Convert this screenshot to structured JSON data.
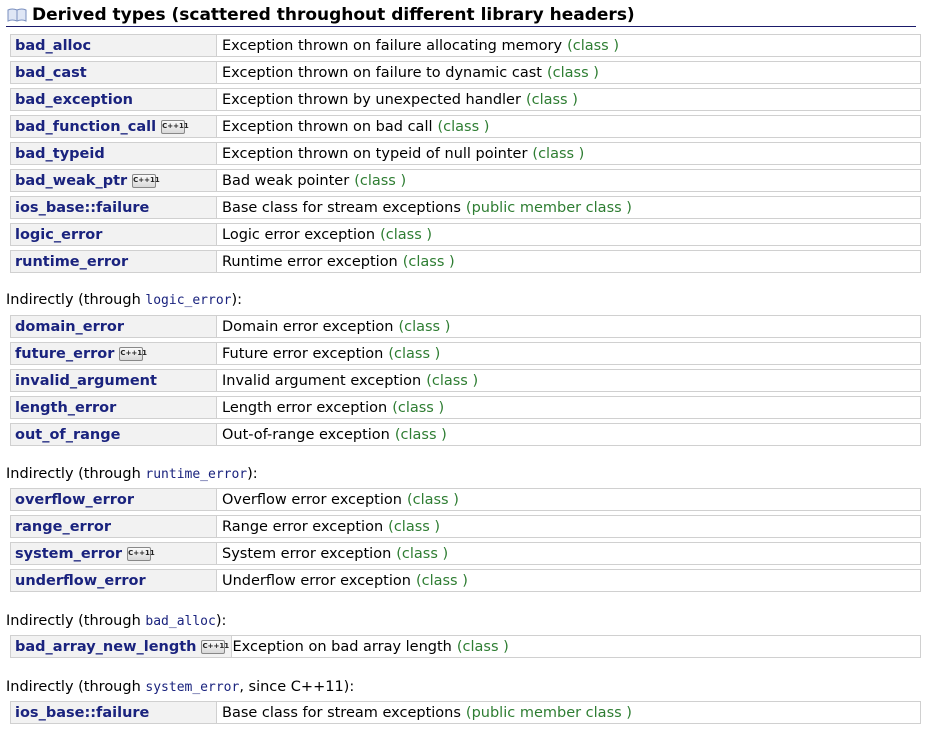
{
  "header": {
    "title": "Derived types (scattered throughout different library headers)"
  },
  "cxx_badge": "C++11",
  "groups": [
    {
      "rows": [
        {
          "name": "bad_alloc",
          "desc": "Exception thrown on failure allocating memory",
          "kind": "(class )"
        },
        {
          "name": "bad_cast",
          "desc": "Exception thrown on failure to dynamic cast",
          "kind": "(class )"
        },
        {
          "name": "bad_exception",
          "desc": "Exception thrown by unexpected handler",
          "kind": "(class )"
        },
        {
          "name": "bad_function_call",
          "desc": "Exception thrown on bad call",
          "kind": "(class )",
          "cxx11": true
        },
        {
          "name": "bad_typeid",
          "desc": "Exception thrown on typeid of null pointer",
          "kind": "(class )"
        },
        {
          "name": "bad_weak_ptr",
          "desc": "Bad weak pointer",
          "kind": "(class )",
          "cxx11": true
        },
        {
          "name": "ios_base::failure",
          "desc": "Base class for stream exceptions",
          "kind": "(public member class )"
        },
        {
          "name": "logic_error",
          "desc": "Logic error exception",
          "kind": "(class )"
        },
        {
          "name": "runtime_error",
          "desc": "Runtime error exception",
          "kind": "(class )"
        }
      ]
    },
    {
      "label_prefix": "Indirectly (through ",
      "label_code": "logic_error",
      "label_suffix": "):",
      "rows": [
        {
          "name": "domain_error",
          "desc": "Domain error exception",
          "kind": "(class )"
        },
        {
          "name": "future_error",
          "desc": "Future error exception",
          "kind": "(class )",
          "cxx11": true
        },
        {
          "name": "invalid_argument",
          "desc": "Invalid argument exception",
          "kind": "(class )"
        },
        {
          "name": "length_error",
          "desc": "Length error exception",
          "kind": "(class )"
        },
        {
          "name": "out_of_range",
          "desc": "Out-of-range exception",
          "kind": "(class )"
        }
      ]
    },
    {
      "label_prefix": "Indirectly (through ",
      "label_code": "runtime_error",
      "label_suffix": "):",
      "rows": [
        {
          "name": "overflow_error",
          "desc": "Overflow error exception",
          "kind": "(class )"
        },
        {
          "name": "range_error",
          "desc": "Range error exception",
          "kind": "(class )"
        },
        {
          "name": "system_error",
          "desc": "System error exception",
          "kind": "(class )",
          "cxx11": true
        },
        {
          "name": "underflow_error",
          "desc": "Underflow error exception",
          "kind": "(class )"
        }
      ]
    },
    {
      "label_prefix": "Indirectly (through ",
      "label_code": "bad_alloc",
      "label_suffix": "):",
      "rows": [
        {
          "name": "bad_array_new_length",
          "desc": "Exception on bad array length",
          "kind": "(class )",
          "cxx11": true,
          "wide": true
        }
      ]
    },
    {
      "label_prefix": "Indirectly (through ",
      "label_code": "system_error",
      "label_suffix": ", since C++11):",
      "rows": [
        {
          "name": "ios_base::failure",
          "desc": "Base class for stream exceptions",
          "kind": "(public member class )"
        }
      ]
    }
  ]
}
